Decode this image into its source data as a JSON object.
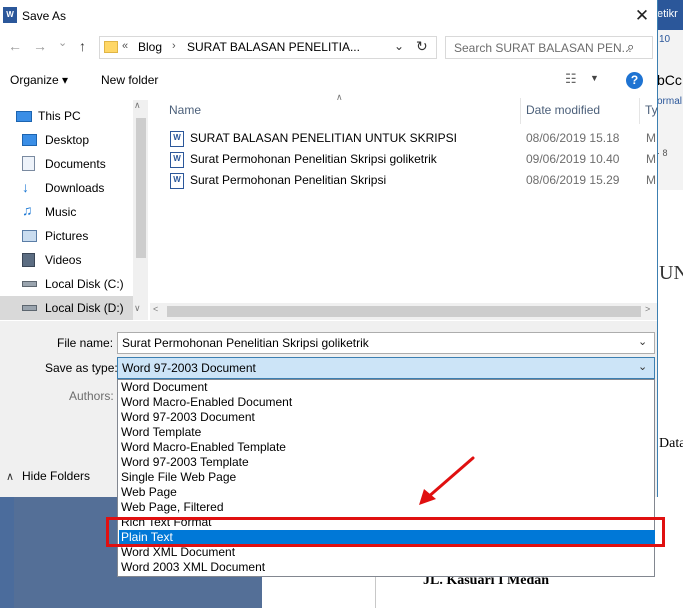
{
  "background": {
    "ribbon_text": "etikr",
    "ribbon_10": "10",
    "ribbon_bcc": "bCc",
    "ribbon_ormal": "ormal",
    "ruler_8": "· 8",
    "doc_un": "UN",
    "doc_data": "Data",
    "doc_address": "JL. Kasuari I Medan"
  },
  "dialog": {
    "title": "Save As",
    "close_glyph": "✕"
  },
  "nav": {
    "back": "←",
    "forward": "→",
    "dropdown": "⌄",
    "up": "↑",
    "crumb_sep": "«",
    "crumbs": [
      "Blog",
      "SURAT BALASAN PENELITIA..."
    ],
    "crumb_arrow": "›",
    "address_dropdown": "⌄",
    "refresh": "↻",
    "search_placeholder": "Search SURAT BALASAN PEN...",
    "search_icon": "⌕"
  },
  "toolbar": {
    "organize": "Organize ▾",
    "new_folder": "New folder",
    "view_icon": "☷",
    "view_dropdown": "▼",
    "help": "?"
  },
  "tree": {
    "items": [
      {
        "label": "This PC",
        "icon": "pc-icon"
      },
      {
        "label": "Desktop",
        "icon": "desktop-icon"
      },
      {
        "label": "Documents",
        "icon": "documents-icon"
      },
      {
        "label": "Downloads",
        "icon": "downloads-icon"
      },
      {
        "label": "Music",
        "icon": "music-icon"
      },
      {
        "label": "Pictures",
        "icon": "pictures-icon"
      },
      {
        "label": "Videos",
        "icon": "videos-icon"
      },
      {
        "label": "Local Disk (C:)",
        "icon": "drive-icon"
      },
      {
        "label": "Local Disk (D:)",
        "icon": "drive-icon"
      }
    ],
    "scroll_up": "∧",
    "scroll_down": "∨"
  },
  "files": {
    "columns": {
      "name": "Name",
      "date": "Date modified",
      "type": "Ty"
    },
    "sort_glyph": "∧",
    "rows": [
      {
        "name": "SURAT BALASAN PENELITIAN UNTUK SKRIPSI",
        "date": "08/06/2019 15.18",
        "type": "M"
      },
      {
        "name": "Surat Permohonan Penelitian Skripsi  goliketrik",
        "date": "09/06/2019 10.40",
        "type": "M"
      },
      {
        "name": "Surat Permohonan Penelitian Skripsi",
        "date": "08/06/2019 15.29",
        "type": "M"
      }
    ],
    "scroll_left": "<",
    "scroll_right": ">"
  },
  "form": {
    "file_name_label": "File name:",
    "file_name_value": "Surat Permohonan Penelitian Skripsi  goliketrik",
    "save_type_label": "Save as type:",
    "save_type_value": "Word 97-2003 Document",
    "dd_glyph": "⌄",
    "authors_label": "Authors:",
    "hide_icon": "∧",
    "hide_folders": "Hide Folders"
  },
  "save_types": [
    "Word Document",
    "Word Macro-Enabled Document",
    "Word 97-2003 Document",
    "Word Template",
    "Word Macro-Enabled Template",
    "Word 97-2003 Template",
    "Single File Web Page",
    "Web Page",
    "Web Page, Filtered",
    "Rich Text Format",
    "Plain Text",
    "Word XML Document",
    "Word 2003 XML Document"
  ],
  "selected_save_type": "Plain Text",
  "colors": {
    "selection": "#0078d7",
    "highlight_annotation": "#e01010",
    "word_blue": "#2b579a"
  }
}
